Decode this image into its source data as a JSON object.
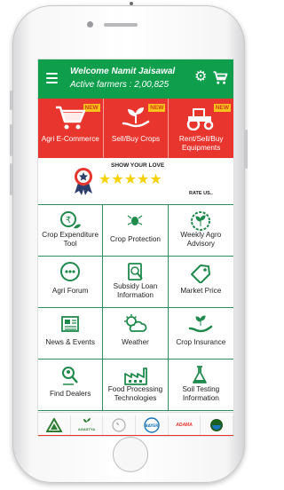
{
  "header": {
    "welcome": "Welcome Namit Jaisawal",
    "active_farmers": "Active farmers : 2,00,825"
  },
  "top_tiles": [
    {
      "label": "Agri E-Commerce",
      "badge": "NEW",
      "icon": "cart-icon"
    },
    {
      "label": "Sell/Buy Crops",
      "badge": "NEW",
      "icon": "plant-hand-icon"
    },
    {
      "label": "Rent/Sell/Buy Equipments",
      "badge": "NEW",
      "icon": "tractor-icon"
    }
  ],
  "love": {
    "title": "SHOW YOUR LOVE",
    "stars": "★★★★★",
    "rate": "RATE US.."
  },
  "grid": [
    {
      "label": "Crop Expenditure Tool",
      "icon": "rupee-plant-icon"
    },
    {
      "label": "Crop Protection",
      "icon": "bug-icon"
    },
    {
      "label": "Weekly Agro Advisory",
      "icon": "sprout-badge-icon"
    },
    {
      "label": "Agri Forum",
      "icon": "chat-icon"
    },
    {
      "label": "Subsidy Loan Information",
      "icon": "loan-document-icon"
    },
    {
      "label": "Market Price",
      "icon": "price-tag-icon"
    },
    {
      "label": "News & Events",
      "icon": "newspaper-icon"
    },
    {
      "label": "Weather",
      "icon": "weather-icon"
    },
    {
      "label": "Crop Insurance",
      "icon": "insurance-hand-icon"
    },
    {
      "label": "Find Dealers",
      "icon": "dealer-search-icon"
    },
    {
      "label": "Food Processing Technologies",
      "icon": "factory-icon"
    },
    {
      "label": "Soil Testing Information",
      "icon": "soil-test-icon"
    }
  ],
  "partners": [
    "AGASTYA",
    "BAYER",
    "ADAMA"
  ],
  "colors": {
    "header": "#0e9e4c",
    "tiles": "#e8352e",
    "grid_line": "#2a8f5c",
    "icon_green": "#1f8a4c"
  }
}
